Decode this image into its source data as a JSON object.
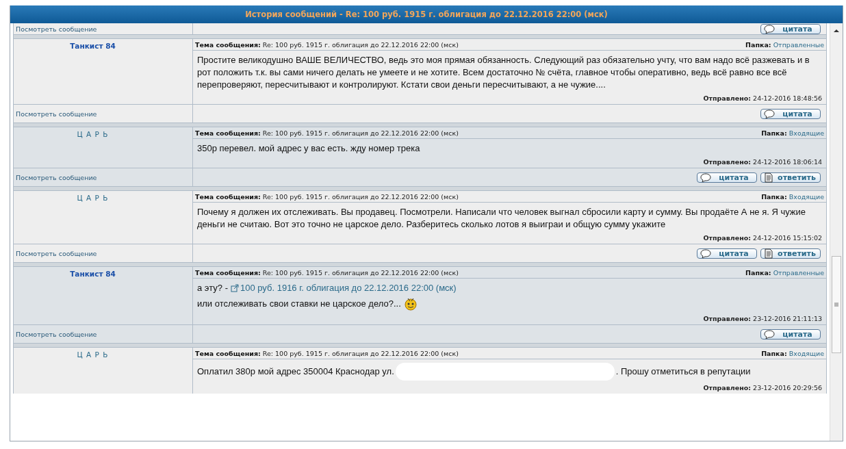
{
  "window": {
    "title": "История сообщений - Re: 100 руб. 1915 г. облигация до 22.12.2016 22:00 (мск)"
  },
  "top_footer": {
    "view_link": "Посмотреть сообщение",
    "buttons": [
      {
        "kind": "quote",
        "label": "цитата"
      }
    ]
  },
  "messages": [
    {
      "author": "Танкист 84",
      "kind": "member",
      "subject_label": "Тема сообщения:",
      "subject": "Re: 100 руб. 1915 г. облигация до 22.12.2016 22:00 (мск)",
      "folder_label": "Папка:",
      "folder": "Отправленные",
      "paragraphs": [
        {
          "text": "Простите великодушно ВАШЕ ВЕЛИЧЕСТВО, ведь это моя прямая обязанность. Следующий раз обязательно учту, что вам надо всё разжевать и в рот положить т.к. вы сами ничего делать не умеете и не хотите. Всем достаточно № счёта, главное чтобы оперативно, ведь всё равно все всё перепроверяют, пересчитывают и контролируют. Кстати свои деньги пересчитывают, а не чужие...."
        }
      ],
      "sent_label": "Отправлено:",
      "sent": "24-12-2016 18:48:56",
      "footer": {
        "view_link": "Посмотреть сообщение",
        "buttons": [
          {
            "kind": "quote",
            "label": "цитата"
          }
        ]
      }
    },
    {
      "author": "Ц А Р Ь",
      "kind": "king",
      "subject_label": "Тема сообщения:",
      "subject": "Re: 100 руб. 1915 г. облигация до 22.12.2016 22:00 (мск)",
      "folder_label": "Папка:",
      "folder": "Входящие",
      "paragraphs": [
        {
          "text": "350р перевел. мой адрес у вас есть. жду номер трека"
        }
      ],
      "sent_label": "Отправлено:",
      "sent": "24-12-2016 18:06:14",
      "footer": {
        "view_link": "Посмотреть сообщение",
        "buttons": [
          {
            "kind": "quote",
            "label": "цитата"
          },
          {
            "kind": "reply",
            "label": "ответить"
          }
        ]
      }
    },
    {
      "author": "Ц А Р Ь",
      "kind": "king",
      "subject_label": "Тема сообщения:",
      "subject": "Re: 100 руб. 1915 г. облигация до 22.12.2016 22:00 (мск)",
      "folder_label": "Папка:",
      "folder": "Входящие",
      "paragraphs": [
        {
          "text": "Почему я должен их отслеживать. Вы продавец. Посмотрели. Написали что человек выгнал сбросили карту и сумму. Вы продаёте А не я. Я чужие деньги не считаю. Вот это точно не царское дело. Разберитесь сколько лотов я выиграи и общую сумму укажите"
        }
      ],
      "sent_label": "Отправлено:",
      "sent": "24-12-2016 15:15:02",
      "footer": {
        "view_link": "Посмотреть сообщение",
        "buttons": [
          {
            "kind": "quote",
            "label": "цитата"
          },
          {
            "kind": "reply",
            "label": "ответить"
          }
        ]
      }
    },
    {
      "author": "Танкист 84",
      "kind": "member",
      "subject_label": "Тема сообщения:",
      "subject": "Re: 100 руб. 1915 г. облигация до 22.12.2016 22:00 (мск)",
      "folder_label": "Папка:",
      "folder": "Отправленные",
      "paragraphs": [
        {
          "text": "а эту? -",
          "link": "100 руб. 1916 г. облигация до 22.12.2016 22:00 (мск)"
        },
        {
          "text": "или отслеживать свои ставки не царское дело?...",
          "smiley": true
        }
      ],
      "sent_label": "Отправлено:",
      "sent": "23-12-2016 21:11:13",
      "footer": {
        "view_link": "Посмотреть сообщение",
        "buttons": [
          {
            "kind": "quote",
            "label": "цитата"
          }
        ]
      }
    },
    {
      "author": "Ц А Р Ь",
      "kind": "king",
      "subject_label": "Тема сообщения:",
      "subject": "Re: 100 руб. 1915 г. облигация до 22.12.2016 22:00 (мск)",
      "folder_label": "Папка:",
      "folder": "Входящие",
      "paragraphs": [
        {
          "text": "Оплатил 380р мой адрес 350004 Краснодар ул.",
          "redacted": true,
          "text_after": ". Прошу отметиться в репутации"
        }
      ],
      "sent_label": "Отправлено:",
      "sent": "23-12-2016 20:29:56"
    }
  ]
}
